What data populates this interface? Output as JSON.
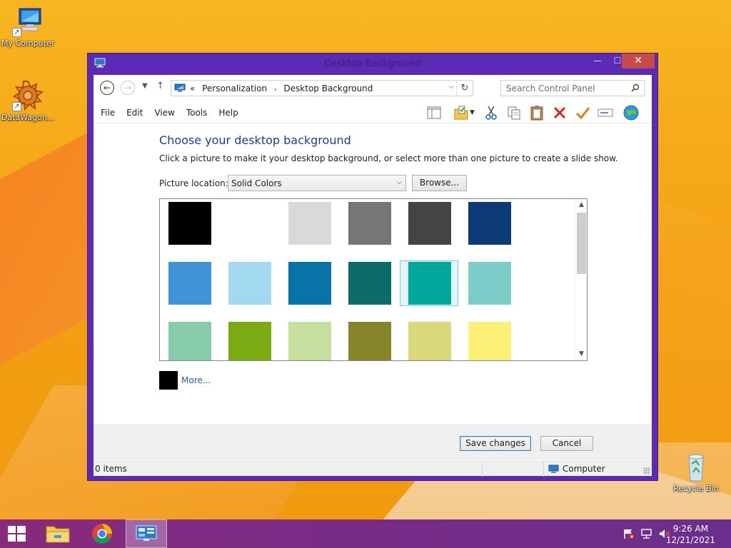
{
  "desktop": {
    "icons": [
      {
        "label": "My Computer"
      },
      {
        "label": "DataWagon..."
      },
      {
        "label": "Recycle Bin"
      }
    ]
  },
  "window": {
    "title": "Desktop Background",
    "controls": {
      "minimize": "—",
      "maximize": "☐",
      "close": "✕"
    }
  },
  "address": {
    "overflow": "«",
    "crumbs": [
      "Personalization",
      "Desktop Background"
    ],
    "separator": "›"
  },
  "search": {
    "placeholder": "Search Control Panel"
  },
  "menu": [
    "File",
    "Edit",
    "View",
    "Tools",
    "Help"
  ],
  "main": {
    "heading": "Choose your desktop background",
    "subtext": "Click a picture to make it your desktop background, or select more than one picture to create a slide show.",
    "location_label": "Picture location:",
    "location_value": "Solid Colors",
    "browse_label": "Browse...",
    "more_label": "More...",
    "more_color": "#000000"
  },
  "swatches": [
    [
      "#000000",
      "#ffffff",
      "#d9d9d9",
      "#767676",
      "#444444",
      "#0d3b75"
    ],
    [
      "#3f94d6",
      "#a3d9ef",
      "#0773a6",
      "#0d6b6a",
      "#00a89c",
      "#7ccdc9"
    ],
    [
      "#86ccaa",
      "#7aab12",
      "#c6df9e",
      "#86852a",
      "#d9d97a",
      "#fcf176"
    ]
  ],
  "selected_swatch": {
    "row": 1,
    "col": 4
  },
  "buttons": {
    "save": "Save changes",
    "cancel": "Cancel"
  },
  "status": {
    "items": "0 items",
    "location": "Computer"
  },
  "taskbar": {
    "time": "9:26 AM",
    "date": "12/21/2021"
  }
}
